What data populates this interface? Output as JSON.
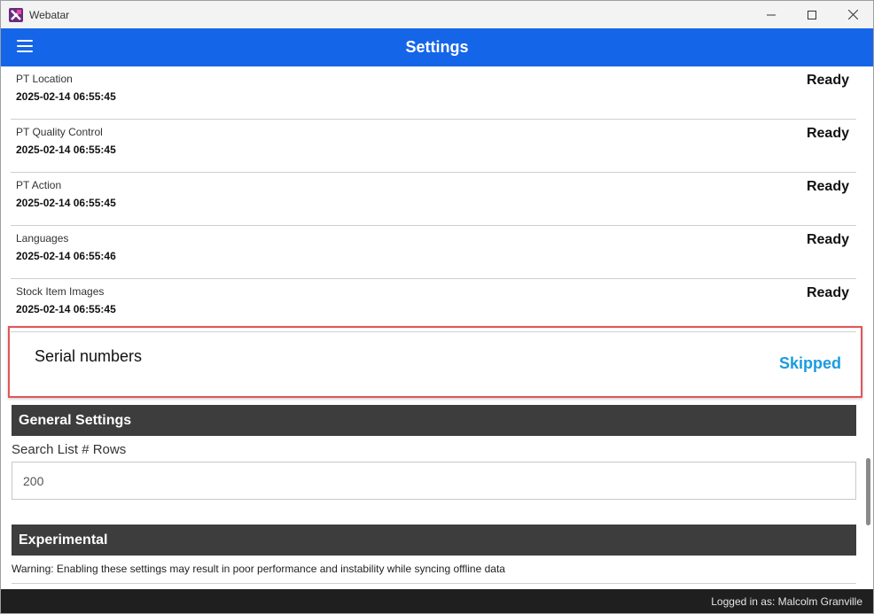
{
  "window": {
    "title": "Webatar"
  },
  "appbar": {
    "title": "Settings"
  },
  "sync_items": [
    {
      "name": "PT Location",
      "timestamp": "2025-02-14 06:55:45",
      "status": "Ready"
    },
    {
      "name": "PT Quality Control",
      "timestamp": "2025-02-14 06:55:45",
      "status": "Ready"
    },
    {
      "name": "PT Action",
      "timestamp": "2025-02-14 06:55:45",
      "status": "Ready"
    },
    {
      "name": "Languages",
      "timestamp": "2025-02-14 06:55:46",
      "status": "Ready"
    },
    {
      "name": "Stock Item Images",
      "timestamp": "2025-02-14 06:55:45",
      "status": "Ready"
    }
  ],
  "serial": {
    "name": "Serial numbers",
    "status": "Skipped"
  },
  "general_settings": {
    "header": "General Settings",
    "search_rows_label": "Search List # Rows",
    "search_rows_value": "200"
  },
  "experimental": {
    "header": "Experimental",
    "warning": "Warning: Enabling these settings may result in poor performance and instability while syncing offline data"
  },
  "status_bar": {
    "logged_in": "Logged in as: Malcolm Granville"
  },
  "colors": {
    "appbar": "#1565e8",
    "skipped": "#1a9be0",
    "highlight_border": "#e0565a",
    "section_header": "#3d3d3d",
    "status_bar": "#1f1f1f"
  }
}
